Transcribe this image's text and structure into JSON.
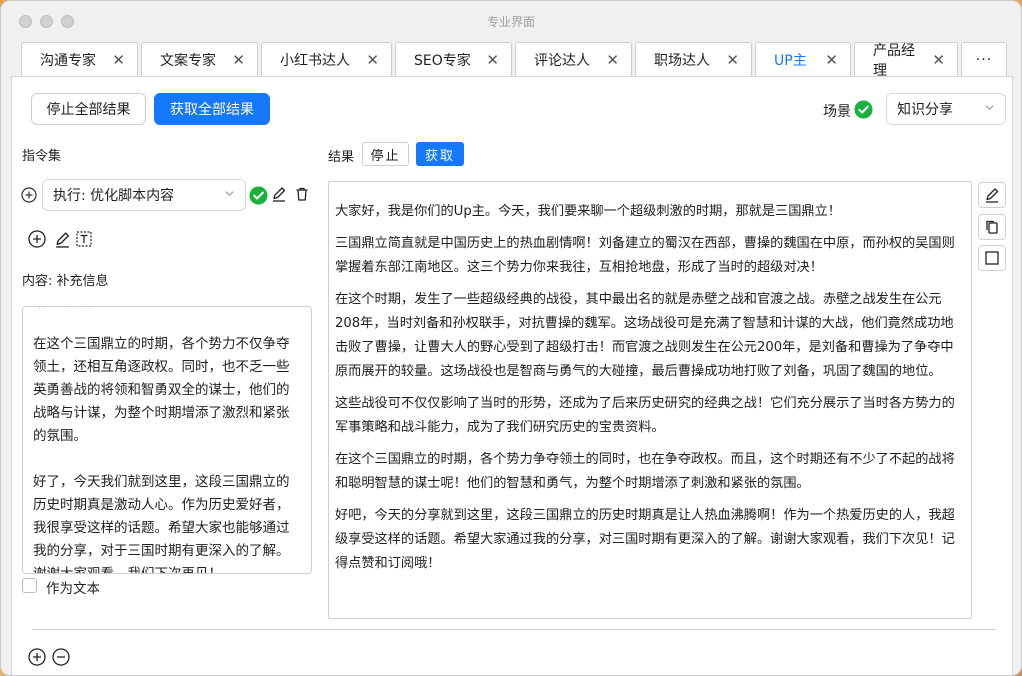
{
  "window": {
    "title": "专业界面"
  },
  "tabs": [
    {
      "label": "沟通专家",
      "close": "✕"
    },
    {
      "label": "文案专家",
      "close": "✕"
    },
    {
      "label": "小红书达人",
      "close": "✕"
    },
    {
      "label": "SEO专家",
      "close": "✕"
    },
    {
      "label": "评论达人",
      "close": "✕"
    },
    {
      "label": "职场达人",
      "close": "✕"
    },
    {
      "label": "UP主",
      "close": "✕",
      "active": true
    },
    {
      "label": "产品经理",
      "close": "✕"
    },
    {
      "label": "···"
    }
  ],
  "toolbar": {
    "stop_all": "停止全部结果",
    "get_all": "获取全部结果",
    "scene_label": "场景",
    "scene_value": "知识分享"
  },
  "instructions": {
    "title": "指令集",
    "command_select": "执行: 优化脚本内容",
    "content_label": "内容: 补充信息",
    "as_text_label": "作为文本",
    "text_cut_line": "给您带来视觉上的盛宴。",
    "text_paragraphs": [
      "在这个三国鼎立的时期，各个势力不仅争夺领土，还相互角逐政权。同时，也不乏一些英勇善战的将领和智勇双全的谋士，他们的战略与计谋，为整个时期增添了激烈和紧张的氛围。",
      "好了，今天我们就到这里，这段三国鼎立的历史时期真是激动人心。作为历史爱好者，我很享受这样的话题。希望大家也能够通过我的分享，对于三国时期有更深入的了解。谢谢大家观看，我们下次再见！"
    ]
  },
  "result": {
    "label": "结果",
    "stop": "停止",
    "get": "获取",
    "paragraphs": [
      "大家好，我是你们的Up主。今天，我们要来聊一个超级刺激的时期，那就是三国鼎立！",
      "三国鼎立简直就是中国历史上的热血剧情啊！刘备建立的蜀汉在西部，曹操的魏国在中原，而孙权的吴国则掌握着东部江南地区。这三个势力你来我往，互相抢地盘，形成了当时的超级对决！",
      "在这个时期，发生了一些超级经典的战役，其中最出名的就是赤壁之战和官渡之战。赤壁之战发生在公元208年，当时刘备和孙权联手，对抗曹操的魏军。这场战役可是充满了智慧和计谋的大战，他们竟然成功地击败了曹操，让曹大人的野心受到了超级打击！而官渡之战则发生在公元200年，是刘备和曹操为了争夺中原而展开的较量。这场战役也是智商与勇气的大碰撞，最后曹操成功地打败了刘备，巩固了魏国的地位。",
      "这些战役可不仅仅影响了当时的形势，还成为了后来历史研究的经典之战！它们充分展示了当时各方势力的军事策略和战斗能力，成为了我们研究历史的宝贵资料。",
      "在这个三国鼎立的时期，各个势力争夺领土的同时，也在争夺政权。而且，这个时期还有不少了不起的战将和聪明智慧的谋士呢！他们的智慧和勇气，为整个时期增添了刺激和紧张的氛围。",
      "好吧，今天的分享就到这里，这段三国鼎立的历史时期真是让人热血沸腾啊！作为一个热爱历史的人，我超级享受这样的话题。希望大家通过我的分享，对三国时期有更深入的了解。谢谢大家观看，我们下次见！记得点赞和订阅哦！"
    ]
  },
  "colors": {
    "accent": "#1677ff",
    "check": "#19b23a"
  }
}
